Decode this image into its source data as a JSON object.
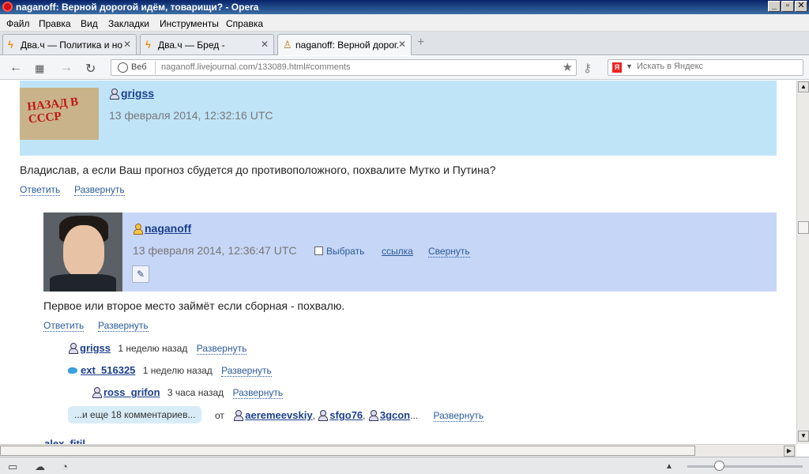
{
  "window": {
    "title": "naganoff: Верной дорогой идём, товарищи? - Opera",
    "minimize": "_",
    "maximize": "▫",
    "close": "✕"
  },
  "menu": [
    "Файл",
    "Правка",
    "Вид",
    "Закладки",
    "Инструменты",
    "Справка"
  ],
  "tabs": [
    {
      "label": "Два.ч — Политика и но...",
      "close": "✕"
    },
    {
      "label": "Два.ч — Бред -",
      "close": "✕"
    },
    {
      "label": "naganoff: Верной дорог...",
      "close": "✕"
    }
  ],
  "newtab": "+",
  "address": {
    "web_label": "Веб",
    "url": "naganoff.livejournal.com/133089.html#comments",
    "search_placeholder": "Искать в Яндекс",
    "search_engine_letter": "Я"
  },
  "comments": {
    "c1": {
      "avatar_text": "НАЗАД В СССР",
      "username": "grigss",
      "date": "13 февраля 2014, 12:32:16 UTC",
      "text": "Владислав, а если Ваш прогноз сбудется до противоположного, похвалите Мутко и Путина?",
      "reply": "Ответить",
      "expand": "Развернуть"
    },
    "c2": {
      "username": "naganoff",
      "date": "13 февраля 2014, 12:36:47 UTC",
      "select": "Выбрать",
      "link": "ссылка",
      "collapse": "Свернуть",
      "text": "Первое или второе место займёт если сборная - похвалю.",
      "reply": "Ответить",
      "expand": "Развернуть"
    },
    "replies": [
      {
        "username": "grigss",
        "time": "1 неделю назад",
        "expand": "Развернуть"
      },
      {
        "username": "ext_516325",
        "time": "1 неделю назад",
        "expand": "Развернуть"
      },
      {
        "username": "ross_grifon",
        "time": "3 часа назад",
        "expand": "Развернуть"
      }
    ],
    "more": {
      "label": "...и еще 18 комментариев...",
      "from": "от",
      "users": [
        "aeremeevskiy",
        "sfgo76",
        "3gcon"
      ],
      "ellipsis": "...",
      "expand": "Развернуть"
    },
    "partial": "alex_fitil"
  }
}
